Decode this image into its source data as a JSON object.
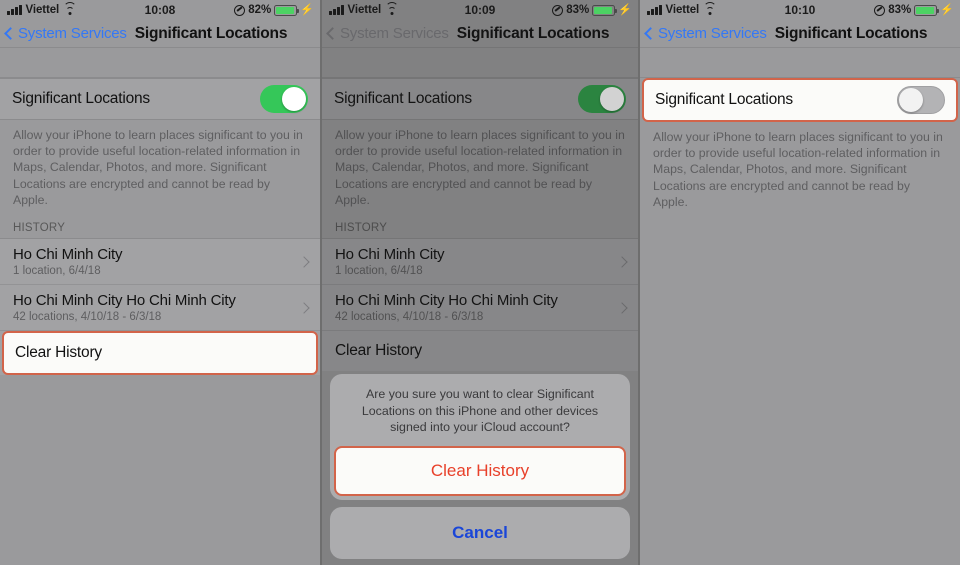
{
  "panels": [
    {
      "status": {
        "carrier": "Viettel",
        "time": "10:08",
        "battery_pct": "82%",
        "wifi_icon": "wifi-icon",
        "signal_icon": "signal-bars-icon",
        "location_icon": "location-services-icon",
        "battery_icon": "battery-icon",
        "charging_icon": "lightning-bolt-icon"
      },
      "nav": {
        "back_label": "System Services",
        "title": "Significant Locations",
        "back_icon": "chevron-left-icon"
      },
      "toggle_row": {
        "label": "Significant Locations",
        "state": "on"
      },
      "footnote": "Allow your iPhone to learn places significant to you in order to provide useful location-related information in Maps, Calendar, Photos, and more. Significant Locations are encrypted and cannot be read by Apple.",
      "section_header": "HISTORY",
      "history": [
        {
          "title": "Ho Chi Minh City",
          "subtitle": "1 location, 6/4/18",
          "chevron": "chevron-right-icon"
        },
        {
          "title": "Ho Chi Minh City Ho Chi Minh City",
          "subtitle": "42 locations, 4/10/18 - 6/3/18",
          "chevron": "chevron-right-icon"
        }
      ],
      "clear_history_label": "Clear History"
    },
    {
      "status": {
        "carrier": "Viettel",
        "time": "10:09",
        "battery_pct": "83%"
      },
      "nav": {
        "back_label": "System Services",
        "title": "Significant Locations"
      },
      "toggle_row": {
        "label": "Significant Locations",
        "state": "on"
      },
      "footnote": "Allow your iPhone to learn places significant to you in order to provide useful location-related information in Maps, Calendar, Photos, and more. Significant Locations are encrypted and cannot be read by Apple.",
      "section_header": "HISTORY",
      "history": [
        {
          "title": "Ho Chi Minh City",
          "subtitle": "1 location, 6/4/18"
        },
        {
          "title": "Ho Chi Minh City Ho Chi Minh City",
          "subtitle": "42 locations, 4/10/18 - 6/3/18"
        }
      ],
      "clear_history_label": "Clear History",
      "alert": {
        "message": "Are you sure you want to clear Significant Locations on this iPhone and other devices signed into your iCloud account?",
        "confirm_label": "Clear History",
        "cancel_label": "Cancel"
      }
    },
    {
      "status": {
        "carrier": "Viettel",
        "time": "10:10",
        "battery_pct": "83%"
      },
      "nav": {
        "back_label": "System Services",
        "title": "Significant Locations"
      },
      "toggle_row": {
        "label": "Significant Locations",
        "state": "off"
      },
      "footnote": "Allow your iPhone to learn places significant to you in order to provide useful location-related information in Maps, Calendar, Photos, and more. Significant Locations are encrypted and cannot be read by Apple."
    }
  ],
  "colors": {
    "highlight_border": "#d2644a",
    "toggle_on": "#35c759",
    "link_blue": "#3478f6",
    "destructive_red": "#e8402a",
    "cancel_blue": "#1a46d8"
  }
}
